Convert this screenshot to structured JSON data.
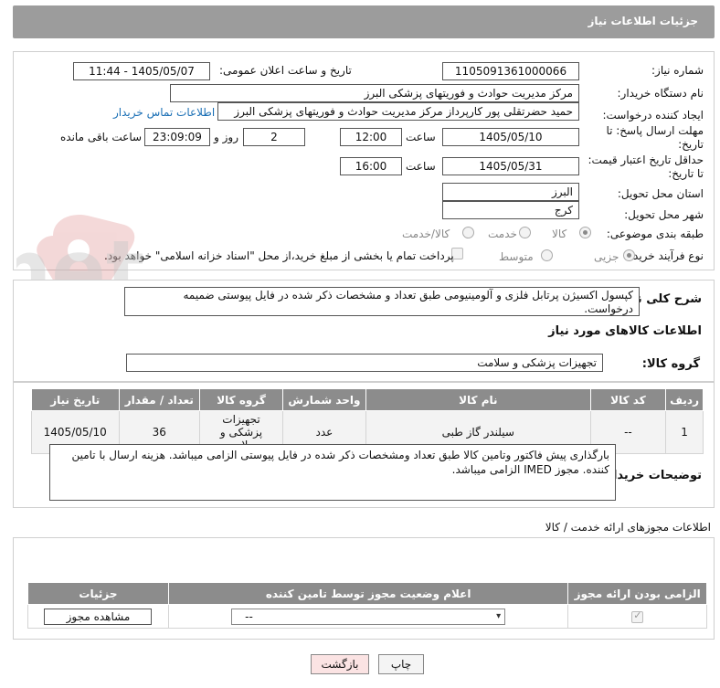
{
  "header": {
    "title": "جزئیات اطلاعات نیاز"
  },
  "form": {
    "need_number_label": "شماره نیاز:",
    "need_number": "1105091361000066",
    "announce_label": "تاریخ و ساعت اعلان عمومی:",
    "announce_value": "1405/05/07 - 11:44",
    "buyer_org_label": "نام دستگاه خریدار:",
    "buyer_org": "مرکز مدیریت حوادث و فوریتهای پزشکی البرز",
    "creator_label": "ایجاد کننده درخواست:",
    "creator": "حمید حضرتقلی پور کارپرداز  مرکز مدیریت حوادث و فوریتهای پزشکی البرز",
    "buyer_contact": "اطلاعات تماس خریدار",
    "reply_deadline_label": "مهلت ارسال پاسخ: تا تاریخ:",
    "reply_date": "1405/05/10",
    "time_label": "ساعت",
    "reply_time": "12:00",
    "days_value": "2",
    "days_label": "روز و",
    "remaining_time": "23:09:09",
    "remaining_label": "ساعت باقی مانده",
    "price_validity_label": "حداقل تاریخ اعتبار قیمت: تا تاریخ:",
    "price_date": "1405/05/31",
    "price_time": "16:00",
    "province_label": "استان محل تحویل:",
    "province": "البرز",
    "city_label": "شهر محل تحویل:",
    "city": "کرج",
    "category_label": "طبقه بندی موضوعی:",
    "category_options": [
      "کالا",
      "خدمت",
      "کالا/خدمت"
    ],
    "process_label": "نوع فرآیند خرید :",
    "process_options": [
      "جزیی",
      "متوسط"
    ],
    "payment_note": "پرداخت تمام یا بخشی از مبلغ خرید،از محل \"اسناد خزانه اسلامی\" خواهد بود."
  },
  "description": {
    "label": "شرح کلی نیاز:",
    "text": "کپسول اکسیژن پرتابل فلزی و آلومینیومی طبق تعداد و مشخصات ذکر شده در فایل پیوستی ضمیمه درخواست."
  },
  "goods": {
    "section_title": "اطلاعات کالاهای مورد نیاز",
    "group_label": "گروه کالا:",
    "group_value": "تجهیزات پزشکی و سلامت",
    "columns": [
      "ردیف",
      "کد کالا",
      "نام کالا",
      "واحد شمارش",
      "گروه کالا",
      "تعداد / مقدار",
      "تاریخ نیاز"
    ],
    "rows": [
      [
        "1",
        "--",
        "سیلندر گاز طبی",
        "عدد",
        "تجهیزات پزشکی و سلامت",
        "36",
        "1405/05/10"
      ]
    ]
  },
  "buyer_notes": {
    "label": "توضیحات خریدار:",
    "text": "بارگذاری پیش فاکتور وتامین کالا طبق تعداد ومشخصات ذکر شده در فایل پیوستی الزامی میباشد. هزینه ارسال با تامین کننده. مجوز IMED الزامی میباشد."
  },
  "permits": {
    "section_title": "اطلاعات مجوزهای ارائه خدمت / کالا",
    "columns": [
      "الزامی بودن ارائه مجوز",
      "اعلام وضعیت مجوز توسط تامین کننده",
      "جزئیات"
    ],
    "select_value": "--",
    "view_button": "مشاهده مجوز"
  },
  "actions": {
    "print": "چاپ",
    "back": "بازگشت"
  },
  "watermark": {
    "text": "AriaTender.net"
  },
  "colors": {
    "header_bg": "#9c9c9c",
    "table_header_bg": "#8c8c8c",
    "link": "#1a6fb5",
    "back_button_bg": "#fbe3e3"
  }
}
